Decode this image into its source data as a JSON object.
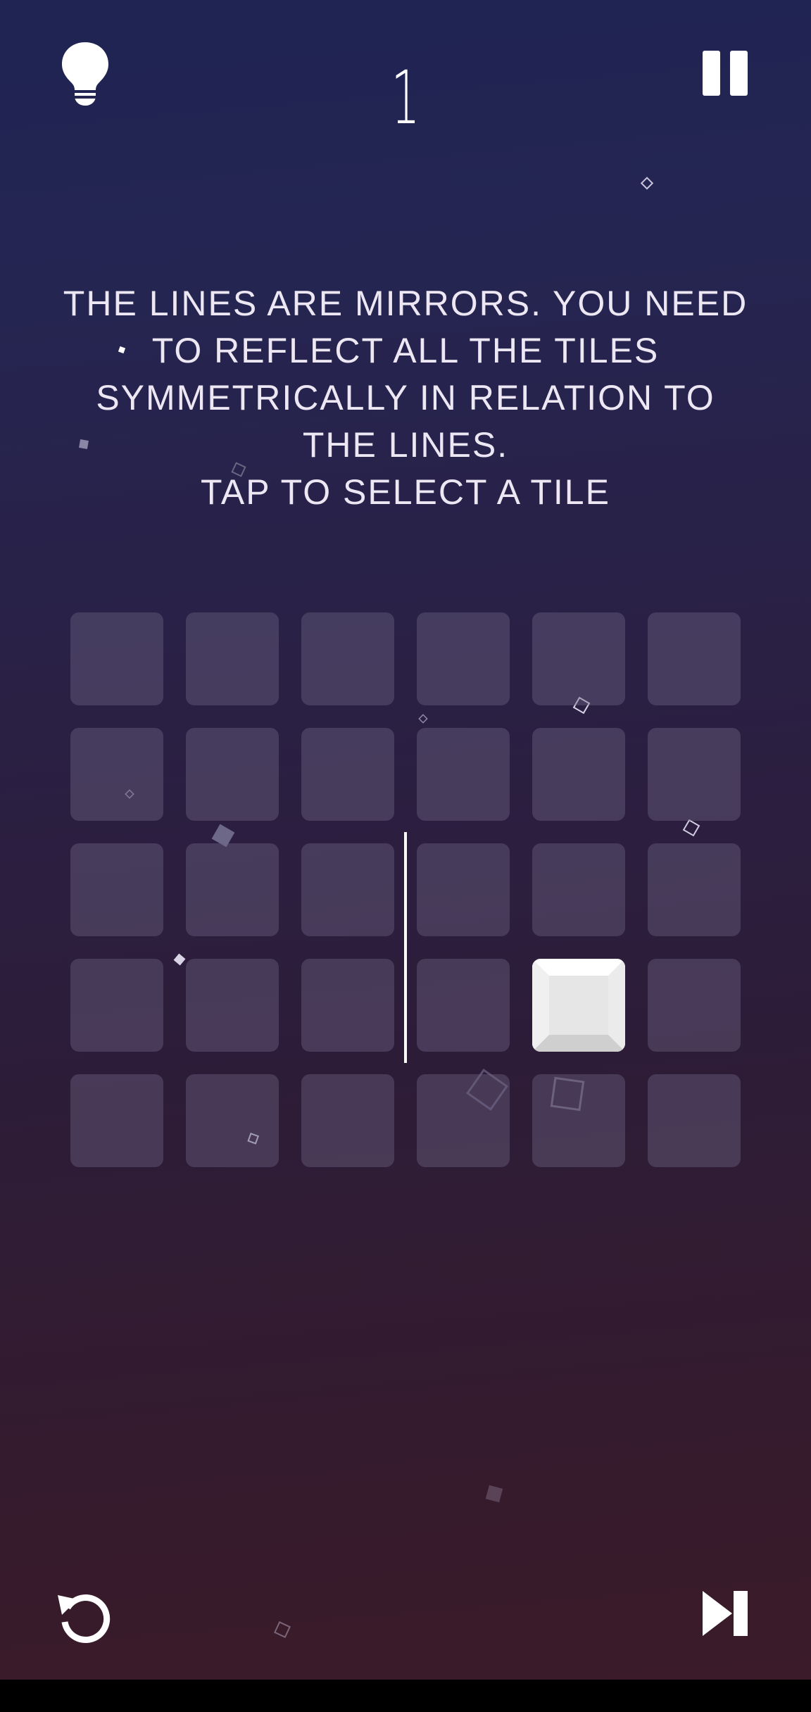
{
  "level": "1",
  "instructions": {
    "lines": [
      "THE LINES ARE MIRRORS. YOU NEED",
      "TO REFLECT ALL THE TILES",
      "SYMMETRICALLY IN RELATION TO",
      "THE LINES.",
      "TAP TO SELECT A TILE"
    ]
  },
  "board": {
    "rows": 5,
    "cols": 6,
    "selected_tile": {
      "row": 4,
      "col": 5
    },
    "mirror_lines": [
      {
        "orientation": "vertical",
        "between_cols": [
          3,
          4
        ],
        "from_row": 3,
        "to_row": 4
      }
    ]
  },
  "icons": {
    "hint": "lightbulb-icon",
    "pause": "pause-icon",
    "restart": "restart-icon",
    "skip": "skip-level-icon"
  },
  "colors": {
    "background_top": "#1f2453",
    "background_bottom": "#3c1b28",
    "tile": "#4a4260",
    "tile_selected": "#ffffff",
    "text": "#ece7f2"
  }
}
